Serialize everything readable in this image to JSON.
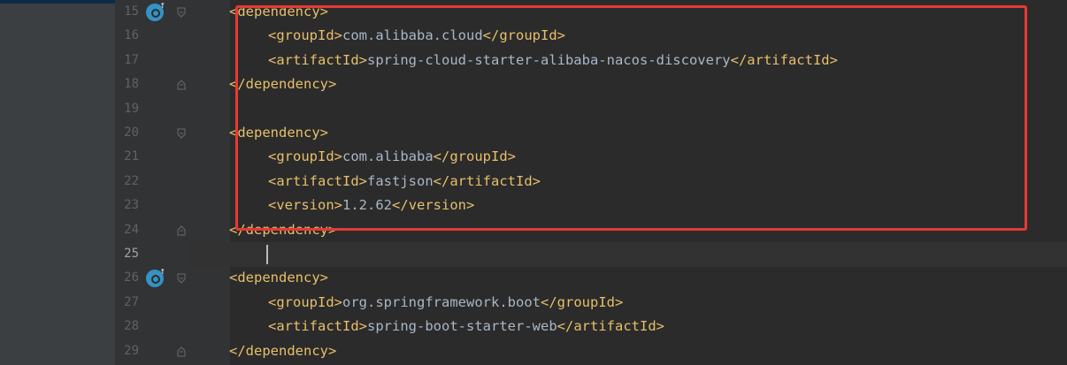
{
  "colors": {
    "tag": "#e8bf6a",
    "text": "#a9b7c6",
    "line_number": "#606366",
    "highlight_border": "#e53935",
    "background": "#2b2b2b"
  },
  "editor": {
    "lines": [
      {
        "num": "15",
        "indent": 0,
        "kind": "open",
        "tag": "dependency",
        "icon": "run-gutter-icon",
        "fold": true
      },
      {
        "num": "16",
        "indent": 1,
        "kind": "elem",
        "tag": "groupId",
        "value": "com.alibaba.cloud"
      },
      {
        "num": "17",
        "indent": 1,
        "kind": "elem",
        "tag": "artifactId",
        "value": "spring-cloud-starter-alibaba-nacos-discovery"
      },
      {
        "num": "18",
        "indent": 0,
        "kind": "close",
        "tag": "dependency",
        "fold": true
      },
      {
        "num": "19",
        "indent": 0,
        "kind": "empty"
      },
      {
        "num": "20",
        "indent": 0,
        "kind": "open",
        "tag": "dependency",
        "fold": true
      },
      {
        "num": "21",
        "indent": 1,
        "kind": "elem",
        "tag": "groupId",
        "value": "com.alibaba"
      },
      {
        "num": "22",
        "indent": 1,
        "kind": "elem",
        "tag": "artifactId",
        "value": "fastjson"
      },
      {
        "num": "23",
        "indent": 1,
        "kind": "elem",
        "tag": "version",
        "value": "1.2.62"
      },
      {
        "num": "24",
        "indent": 0,
        "kind": "close",
        "tag": "dependency",
        "fold": true
      },
      {
        "num": "25",
        "indent": 0,
        "kind": "empty",
        "current": true
      },
      {
        "num": "26",
        "indent": 0,
        "kind": "open",
        "tag": "dependency",
        "icon": "run-gutter-icon",
        "fold": true
      },
      {
        "num": "27",
        "indent": 1,
        "kind": "elem",
        "tag": "groupId",
        "value": "org.springframework.boot"
      },
      {
        "num": "28",
        "indent": 1,
        "kind": "elem",
        "tag": "artifactId",
        "value": "spring-boot-starter-web"
      },
      {
        "num": "29",
        "indent": 0,
        "kind": "close",
        "tag": "dependency",
        "fold": true
      }
    ]
  },
  "annotation": {
    "type": "highlight-rectangle",
    "covers_lines": [
      "15",
      "24"
    ]
  }
}
